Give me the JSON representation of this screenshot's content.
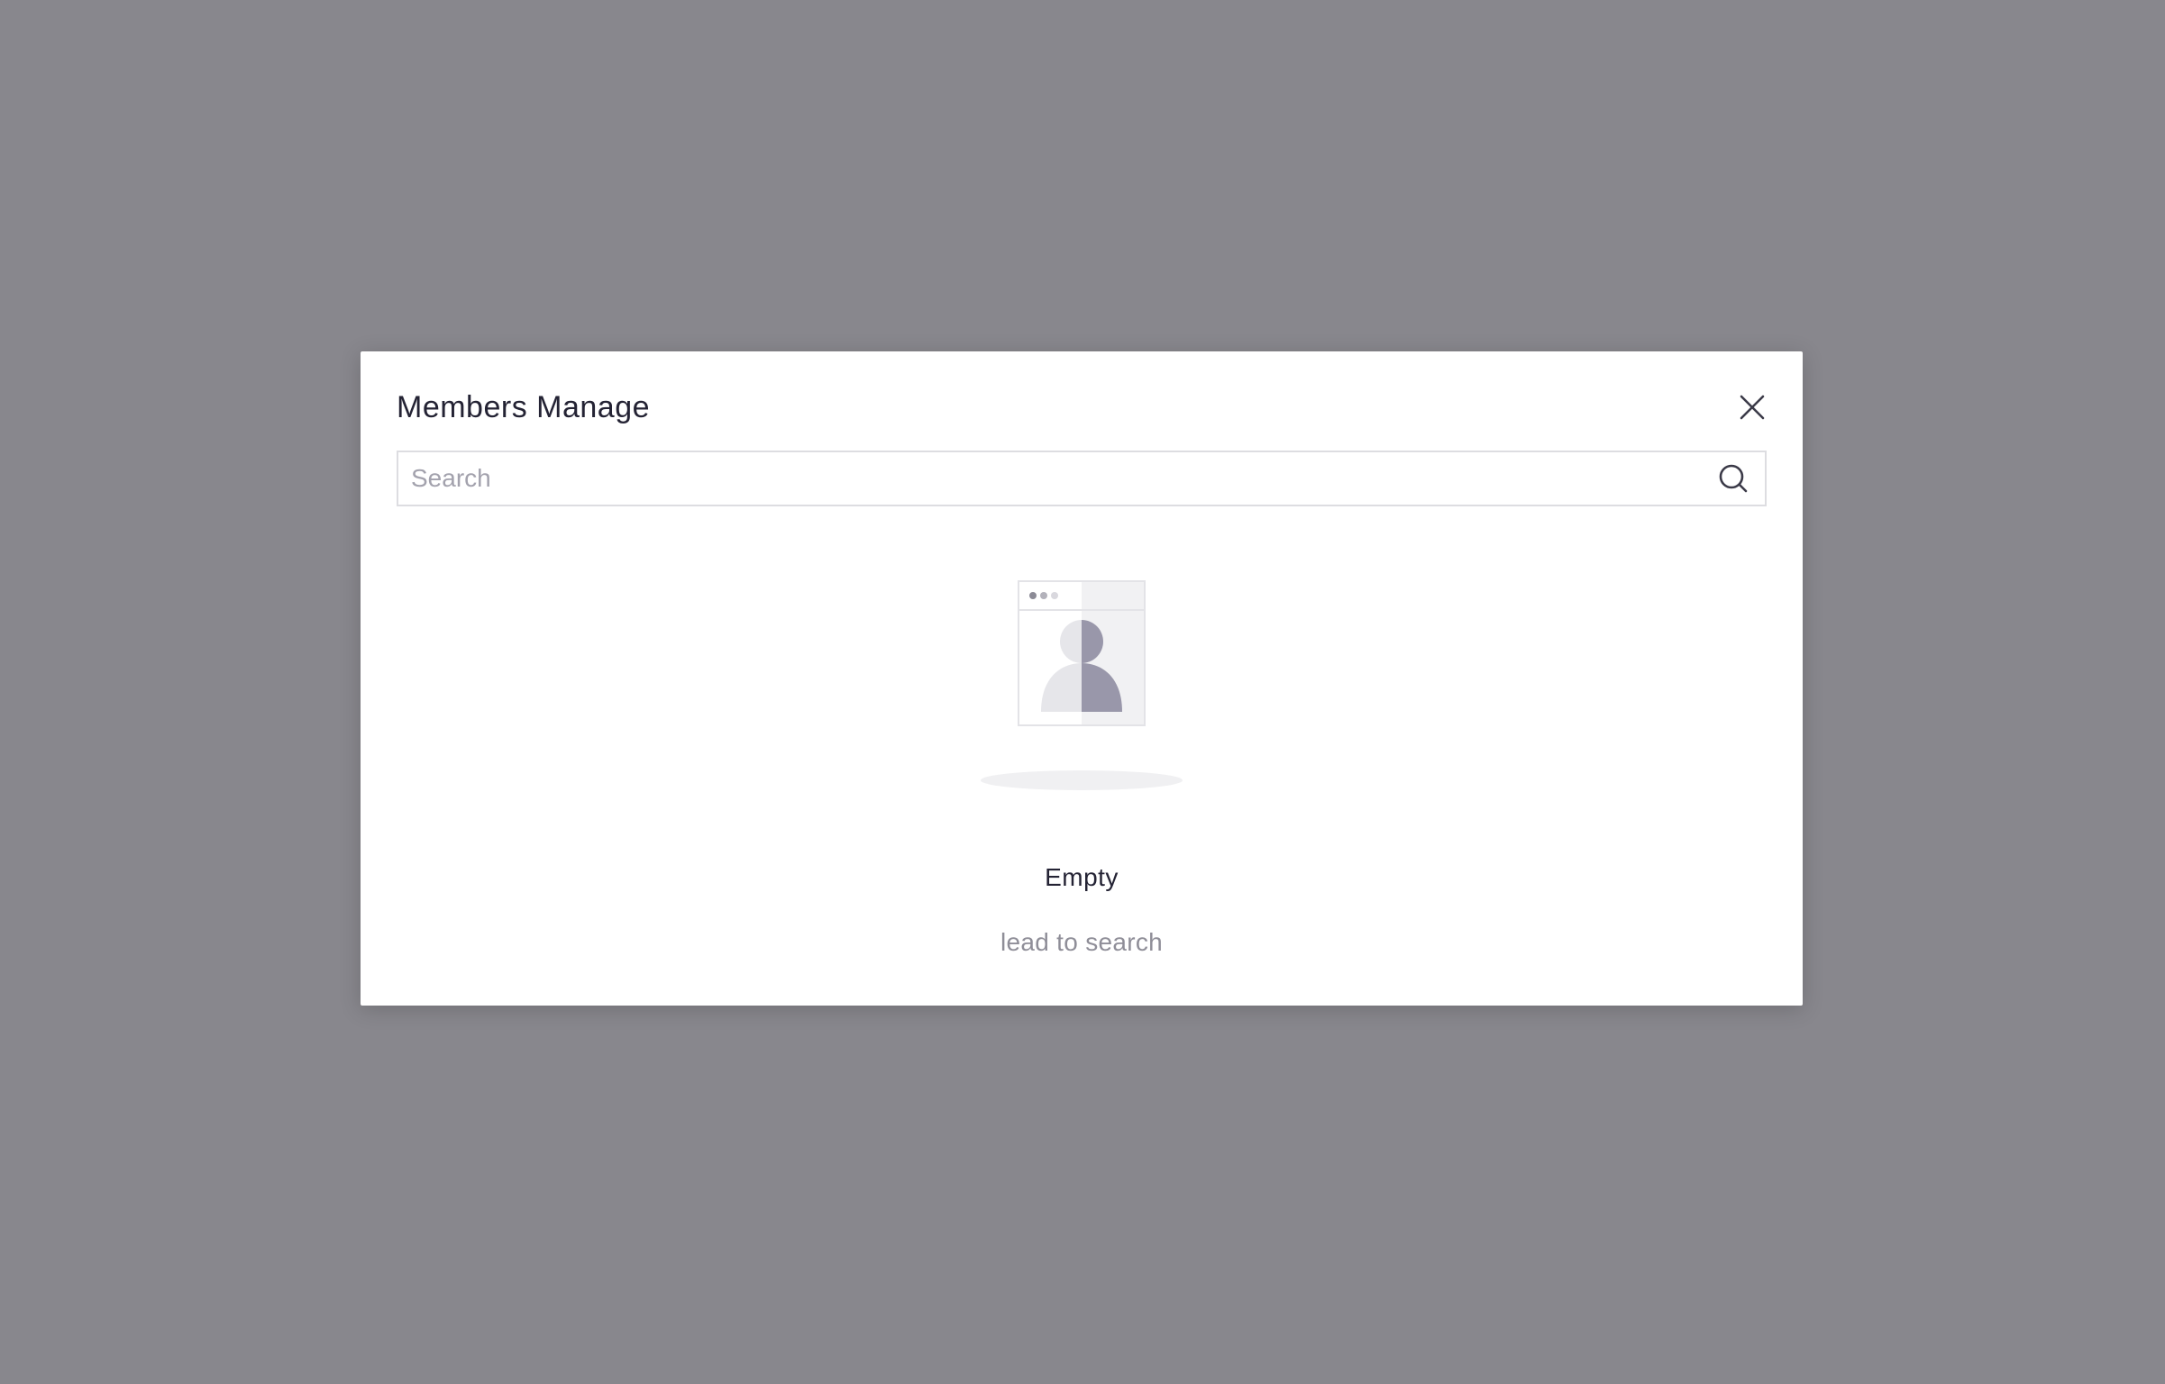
{
  "modal": {
    "title": "Members Manage",
    "close_icon": "close-icon"
  },
  "search": {
    "placeholder": "Search",
    "value": "",
    "icon": "search-icon"
  },
  "empty_state": {
    "illustration": "empty-user-illustration",
    "title": "Empty",
    "description": "lead to search"
  },
  "colors": {
    "overlay": "#88878d",
    "modal_background": "#ffffff",
    "title_text": "#242334",
    "muted_text": "#8f8e98",
    "placeholder_text": "#a3a2ad",
    "input_border": "#dddde1",
    "illustration_accent": "#9997aa"
  }
}
